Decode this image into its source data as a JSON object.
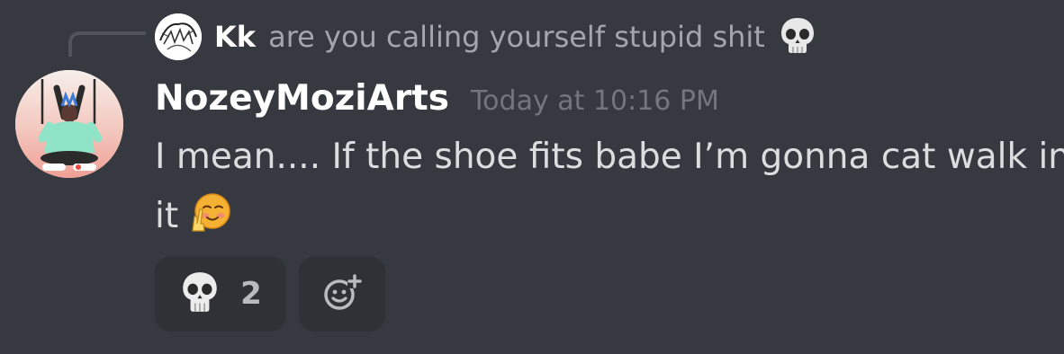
{
  "reply": {
    "author": "Kk",
    "text": "are you calling yourself stupid shit",
    "emoji_icon": "skull-emoji"
  },
  "message": {
    "author": "NozeyMoziArts",
    "timestamp": "Today at 10:16 PM",
    "line1": "I mean.... If the shoe fits babe I’m gonna cat walk in",
    "line2": "it",
    "trailing_emoji_icon": "relieved-peace-emoji"
  },
  "reactions": [
    {
      "emoji_icon": "skull-emoji",
      "count": "2"
    }
  ],
  "add_reaction_icon": "add-reaction-icon",
  "colors": {
    "background": "#36393f",
    "author": "#ffffff",
    "text": "#dcddde",
    "timestamp": "#72767d",
    "reaction_bg": "#2f3136"
  }
}
